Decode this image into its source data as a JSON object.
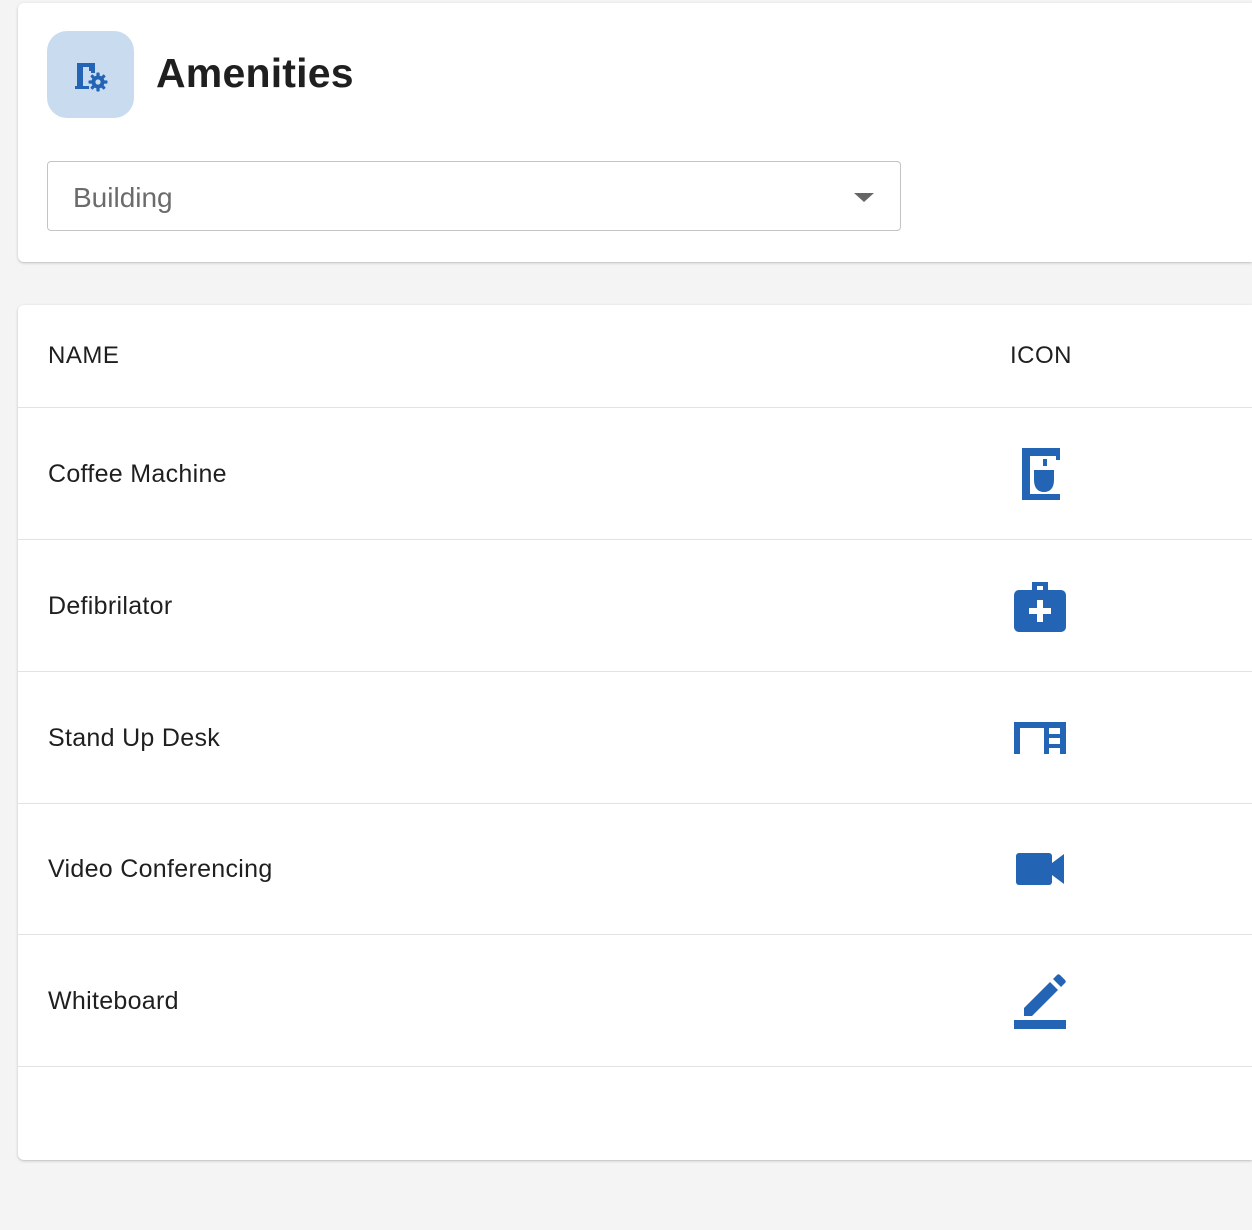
{
  "header": {
    "title": "Amenities",
    "icon": "building-settings-icon"
  },
  "filter": {
    "selected": "Building"
  },
  "table": {
    "columns": [
      "NAME",
      "ICON"
    ],
    "rows": [
      {
        "name": "Coffee Machine",
        "icon": "coffee-maker-icon"
      },
      {
        "name": "Defibrilator",
        "icon": "medical-bag-icon"
      },
      {
        "name": "Stand Up Desk",
        "icon": "desk-icon"
      },
      {
        "name": "Video Conferencing",
        "icon": "videocam-icon"
      },
      {
        "name": "Whiteboard",
        "icon": "border-color-pencil-icon"
      }
    ]
  },
  "colors": {
    "accent": "#2364b5",
    "icon_tile": "#c9dcef",
    "page_background": "#f4f4f4"
  }
}
